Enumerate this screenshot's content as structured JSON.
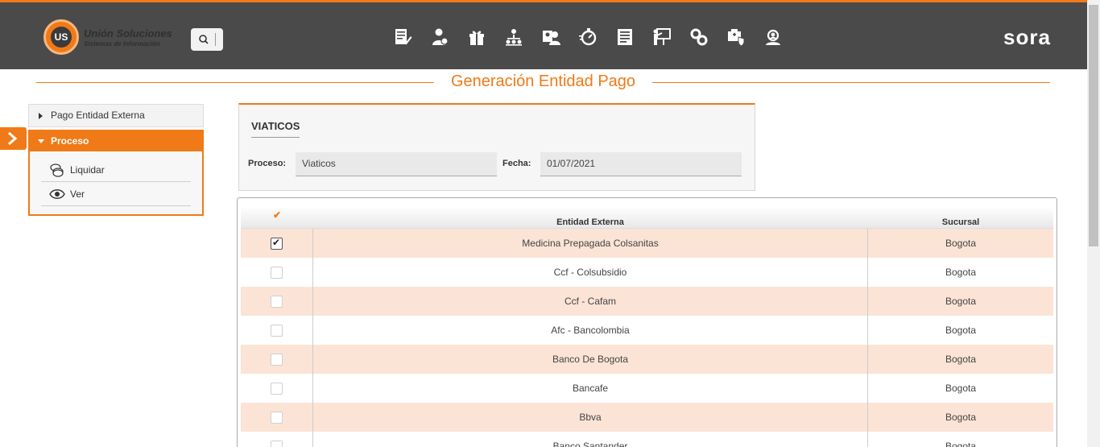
{
  "header": {
    "logo_mark": "US",
    "logo_name": "Unión Soluciones",
    "logo_sub": "Sistemas de Información",
    "brand": "sora",
    "nav_icons": [
      "document-edit-icon",
      "user-money-icon",
      "gift-icon",
      "org-chart-icon",
      "employee-id-icon",
      "stopwatch-icon",
      "report-list-icon",
      "presentation-icon",
      "gears-icon",
      "health-shield-icon",
      "user-search-icon"
    ]
  },
  "page": {
    "title": "Generación Entidad Pago"
  },
  "menu": {
    "collapsed_item": "Pago Entidad Externa",
    "open_item": "Proceso",
    "sub_items": [
      {
        "label": "Liquidar",
        "icon": "coins-icon"
      },
      {
        "label": "Ver",
        "icon": "eye-icon"
      }
    ]
  },
  "panel": {
    "title": "VIATICOS",
    "proceso_label": "Proceso:",
    "proceso_value": "Viaticos",
    "fecha_label": "Fecha:",
    "fecha_value": "01/07/2021"
  },
  "grid": {
    "check_header": "✔",
    "col_entidad": "Entidad Externa",
    "col_sucursal": "Sucursal",
    "rows": [
      {
        "entidad": "Medicina Prepagada Colsanitas",
        "sucursal": "Bogota",
        "checked": true
      },
      {
        "entidad": "Ccf - Colsubsidio",
        "sucursal": "Bogota",
        "checked": false
      },
      {
        "entidad": "Ccf - Cafam",
        "sucursal": "Bogota",
        "checked": false
      },
      {
        "entidad": "Afc - Bancolombia",
        "sucursal": "Bogota",
        "checked": false
      },
      {
        "entidad": "Banco De Bogota",
        "sucursal": "Bogota",
        "checked": false
      },
      {
        "entidad": "Bancafe",
        "sucursal": "Bogota",
        "checked": false
      },
      {
        "entidad": "Bbva",
        "sucursal": "Bogota",
        "checked": false
      },
      {
        "entidad": "Banco Santander",
        "sucursal": "Bogota",
        "checked": false
      }
    ]
  },
  "colors": {
    "accent": "#f07a17",
    "header_bg": "#4a4a4a",
    "row_alt": "#fbe4d5"
  }
}
